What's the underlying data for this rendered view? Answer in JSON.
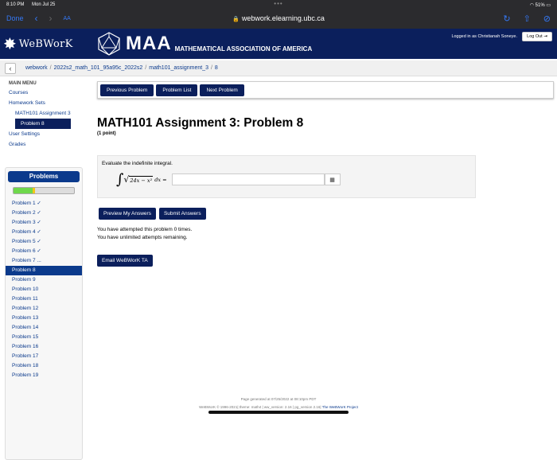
{
  "status": {
    "time": "8:10 PM",
    "date": "Mon Jul 25",
    "battery": "51%"
  },
  "browser": {
    "done": "Done",
    "aa": "AA",
    "url": "webwork.elearning.ubc.ca"
  },
  "banner": {
    "logo_text": "WeBWorK",
    "maa_big": "MAA",
    "maa_small": "MATHEMATICAL ASSOCIATION OF AMERICA",
    "login_text": "Logged in as Christianah Soneye.",
    "logout_label": "Log Out"
  },
  "breadcrumb": [
    "webwork",
    "2022s2_math_101_95a95c_2022s2",
    "math101_assignment_3",
    "8"
  ],
  "sidebar": {
    "menu_head": "MAIN MENU",
    "courses": "Courses",
    "homework_sets": "Homework Sets",
    "assignment": "MATH101 Assignment 3",
    "problem": "Problem 8",
    "user_settings": "User Settings",
    "grades": "Grades"
  },
  "problems_panel": {
    "title": "Problems",
    "progress_correct": 0.32,
    "progress_partial": 0.03,
    "items": [
      "Problem 1 ✓",
      "Problem 2 ✓",
      "Problem 3 ✓",
      "Problem 4 ✓",
      "Problem 5 ✓",
      "Problem 6 ✓",
      "Problem 7 ...",
      "Problem 8",
      "Problem 9",
      "Problem 10",
      "Problem 11",
      "Problem 12",
      "Problem 13",
      "Problem 14",
      "Problem 15",
      "Problem 16",
      "Problem 17",
      "Problem 18",
      "Problem 19"
    ],
    "current_index": 7
  },
  "nav_buttons": {
    "previous": "Previous Problem",
    "list": "Problem List",
    "next": "Next Problem"
  },
  "main": {
    "title": "MATH101 Assignment 3: Problem 8",
    "points": "(1 point)",
    "prompt": "Evaluate the indefinite integral.",
    "integrand": "24x − x²",
    "tail": "dx =",
    "answer_value": "",
    "preview_label": "Preview My Answers",
    "submit_label": "Submit Answers",
    "attempts_line1": "You have attempted this problem 0 times.",
    "attempts_line2": "You have unlimited attempts remaining.",
    "email_label": "Email WeBWorK TA"
  },
  "footer": {
    "generated": "Page generated at 07/25/2022 at 08:10pm PDT",
    "copyright": "WeBWorK © 1996-2021| theme: math4 | ww_version: 2.16 | pg_version 2.16|",
    "project": "The WeBWorK Project"
  }
}
